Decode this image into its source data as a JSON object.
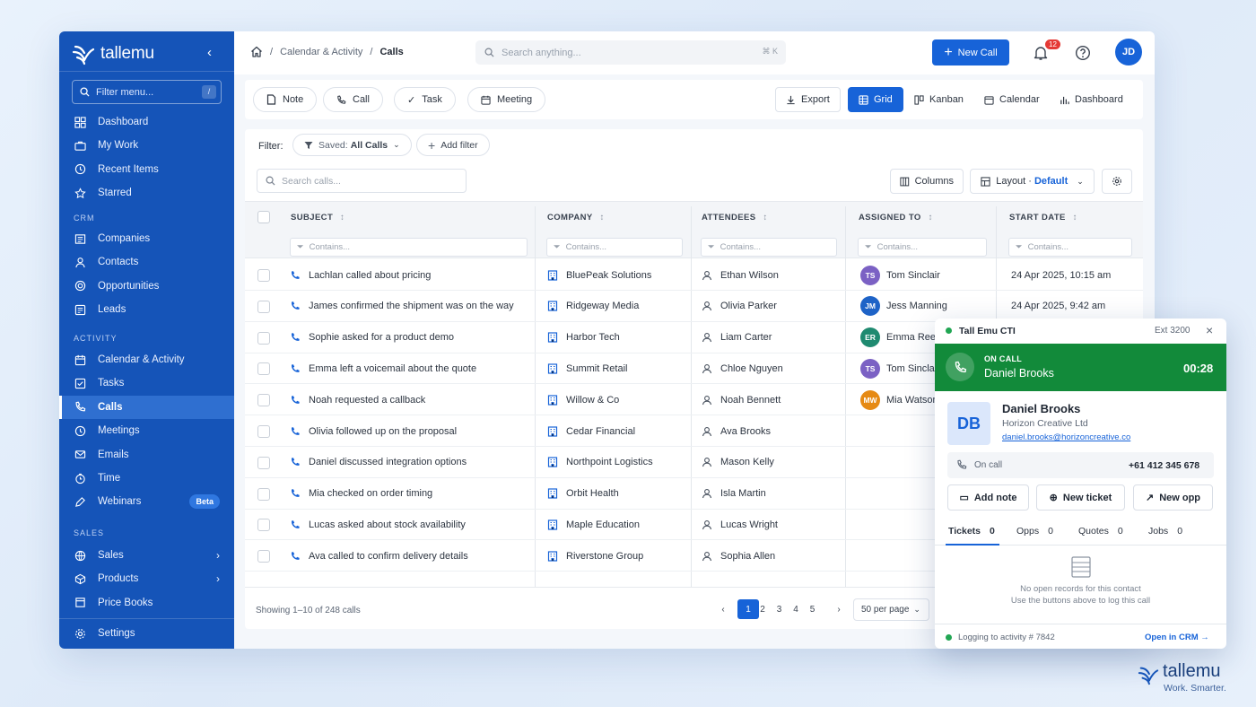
{
  "app": {
    "name": "tallemu"
  },
  "sidebar": {
    "filter_placeholder": "Filter menu...",
    "filter_kbd": "/",
    "top_items": [
      {
        "label": "Dashboard",
        "icon": "dashboard-icon"
      },
      {
        "label": "My Work",
        "icon": "briefcase-icon"
      },
      {
        "label": "Recent Items",
        "icon": "clock-icon"
      },
      {
        "label": "Starred",
        "icon": "star-icon"
      }
    ],
    "section_crm": "CRM",
    "crm_items": [
      {
        "label": "Companies",
        "icon": "companies-icon"
      },
      {
        "label": "Contacts",
        "icon": "contact-icon"
      },
      {
        "label": "Opportunities",
        "icon": "target-icon"
      },
      {
        "label": "Leads",
        "icon": "leads-icon"
      }
    ],
    "section_activity": "ACTIVITY",
    "activity_items": [
      {
        "label": "Calendar & Activity",
        "icon": "calendar-icon"
      },
      {
        "label": "Tasks",
        "icon": "tasks-icon"
      },
      {
        "label": "Calls",
        "icon": "phone-icon",
        "active": true
      },
      {
        "label": "Meetings",
        "icon": "meetings-icon"
      },
      {
        "label": "Emails",
        "icon": "email-icon"
      },
      {
        "label": "Time",
        "icon": "time-icon"
      },
      {
        "label": "Webinars",
        "icon": "webinar-icon",
        "badge": "Beta"
      }
    ],
    "section_sales": "SALES",
    "sales_items": [
      {
        "label": "Sales",
        "icon": "sales-icon"
      },
      {
        "label": "Products",
        "icon": "products-icon"
      },
      {
        "label": "Price Books",
        "icon": "pricebook-icon"
      }
    ],
    "settings_label": "Settings"
  },
  "topbar": {
    "breadcrumb": [
      "Calendar & Activity",
      "Calls"
    ],
    "search_placeholder": "Search anything...",
    "search_kbd": "⌘ K",
    "new_call_label": "New Call",
    "notifications_count": "12",
    "avatar_initials": "JD"
  },
  "toolbar": {
    "quick": [
      "Note",
      "Call",
      "Task",
      "Meeting"
    ],
    "export_label": "Export",
    "views": [
      "Grid",
      "Kanban",
      "Calendar",
      "Dashboard"
    ],
    "active_view": "Grid"
  },
  "filters": {
    "label": "Filter:",
    "saved_prefix": "Saved:",
    "saved_value": "All Calls",
    "add_filter": "Add filter",
    "search_placeholder": "Search calls...",
    "columns_label": "Columns",
    "layout_label": "Layout ·",
    "layout_value": "Default"
  },
  "table": {
    "columns": [
      "SUBJECT",
      "COMPANY",
      "ATTENDEES",
      "ASSIGNED TO",
      "START DATE"
    ],
    "filter_placeholder": "Contains...",
    "rows": [
      {
        "subject": "Lachlan called about pricing",
        "company": "BluePeak Solutions",
        "attendee": "Ethan Wilson",
        "assigned": "Tom Sinclair",
        "initials": "TS",
        "color": "#7b61c4",
        "date": "24 Apr 2025, 10:15 am"
      },
      {
        "subject": "James confirmed the shipment was on the way",
        "company": "Ridgeway Media",
        "attendee": "Olivia Parker",
        "assigned": "Jess Manning",
        "initials": "JM",
        "color": "#1e63c7",
        "date": "24 Apr 2025, 9:42 am"
      },
      {
        "subject": "Sophie asked for a product demo",
        "company": "Harbor Tech",
        "attendee": "Liam Carter",
        "assigned": "Emma Reec",
        "initials": "ER",
        "color": "#1f8a70",
        "date": ""
      },
      {
        "subject": "Emma left a voicemail about the quote",
        "company": "Summit Retail",
        "attendee": "Chloe Nguyen",
        "assigned": "Tom Sinclai",
        "initials": "TS",
        "color": "#7b61c4",
        "date": ""
      },
      {
        "subject": "Noah requested a callback",
        "company": "Willow & Co",
        "attendee": "Noah Bennett",
        "assigned": "Mia Watson",
        "initials": "MW",
        "color": "#e68a14",
        "date": ""
      },
      {
        "subject": "Olivia followed up on the proposal",
        "company": "Cedar Financial",
        "attendee": "Ava Brooks",
        "assigned": "",
        "initials": "",
        "color": "",
        "date": ""
      },
      {
        "subject": "Daniel discussed integration options",
        "company": "Northpoint Logistics",
        "attendee": "Mason Kelly",
        "assigned": "",
        "initials": "",
        "color": "",
        "date": ""
      },
      {
        "subject": "Mia checked on order timing",
        "company": "Orbit Health",
        "attendee": "Isla Martin",
        "assigned": "",
        "initials": "",
        "color": "",
        "date": ""
      },
      {
        "subject": "Lucas asked about stock availability",
        "company": "Maple Education",
        "attendee": "Lucas Wright",
        "assigned": "",
        "initials": "",
        "color": "",
        "date": ""
      },
      {
        "subject": "Ava called to confirm delivery details",
        "company": "Riverstone Group",
        "attendee": "Sophia Allen",
        "assigned": "",
        "initials": "",
        "color": "",
        "date": ""
      }
    ],
    "showing": "Showing 1–10 of 248 calls",
    "pages": [
      "1",
      "2",
      "3",
      "4",
      "5"
    ],
    "current_page": "1",
    "per_page": "50 per page"
  },
  "cti": {
    "title": "Tall Emu CTI",
    "ext": "Ext 3200",
    "status": "ON CALL",
    "caller": "Daniel Brooks",
    "timer": "00:28",
    "contact_initials": "DB",
    "contact_name": "Daniel Brooks",
    "contact_company": "Horizon Creative Ltd",
    "contact_email": "daniel.brooks@horizoncreative.co",
    "oncall_label": "On call",
    "phone": "+61 412 345 678",
    "actions": [
      "Add note",
      "New ticket",
      "New opp"
    ],
    "tabs": [
      {
        "label": "Tickets",
        "count": "0"
      },
      {
        "label": "Opps",
        "count": "0"
      },
      {
        "label": "Quotes",
        "count": "0"
      },
      {
        "label": "Jobs",
        "count": "0"
      }
    ],
    "empty_line1": "No open records for this contact",
    "empty_line2": "Use the buttons above to log this call",
    "logging": "Logging to activity # 7842",
    "open_crm": "Open in CRM →"
  },
  "corner": {
    "brand": "tallemu",
    "tagline": "Work. Smarter."
  },
  "colors": {
    "primary": "#1763d8",
    "sidebar": "#1554b8",
    "oncall": "#128a3a",
    "danger": "#e53935"
  }
}
